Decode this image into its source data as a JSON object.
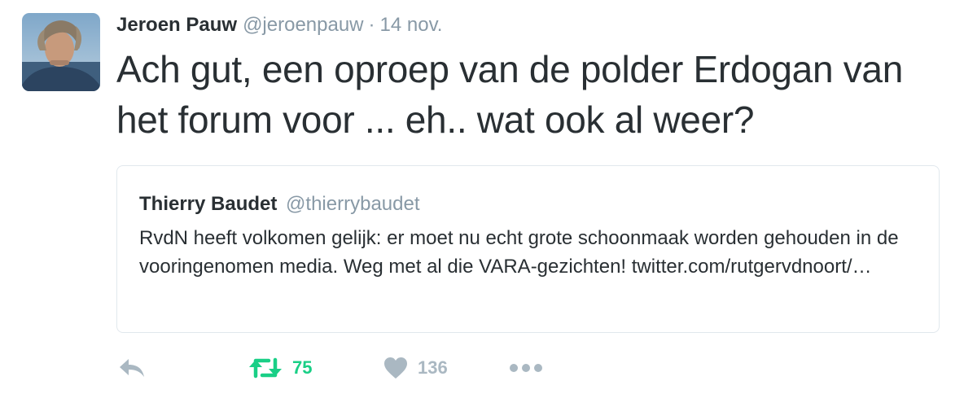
{
  "tweet": {
    "author_name": "Jeroen Pauw",
    "author_handle": "@jeroenpauw",
    "separator": "·",
    "timestamp": "14 nov.",
    "text": "Ach gut, een oproep van de polder Erdogan van het forum voor ... eh.. wat ook al weer?"
  },
  "quoted_tweet": {
    "author_name": "Thierry Baudet",
    "author_handle": "@thierrybaudet",
    "text": "RvdN heeft volkomen gelijk: er moet nu echt grote schoonmaak worden gehouden in de vooringenomen media. Weg met al die VARA-gezichten! twitter.com/rutgervdnoort/…"
  },
  "actions": {
    "reply_icon": "reply-icon",
    "retweet_icon": "retweet-icon",
    "retweet_count": "75",
    "like_icon": "heart-icon",
    "like_count": "136",
    "more_icon": "more-dots-icon"
  },
  "colors": {
    "text": "#292f33",
    "secondary": "#8899a6",
    "retweet_active": "#19cf86",
    "icon_inactive": "#aab8c2",
    "border": "#e1e8ed"
  }
}
